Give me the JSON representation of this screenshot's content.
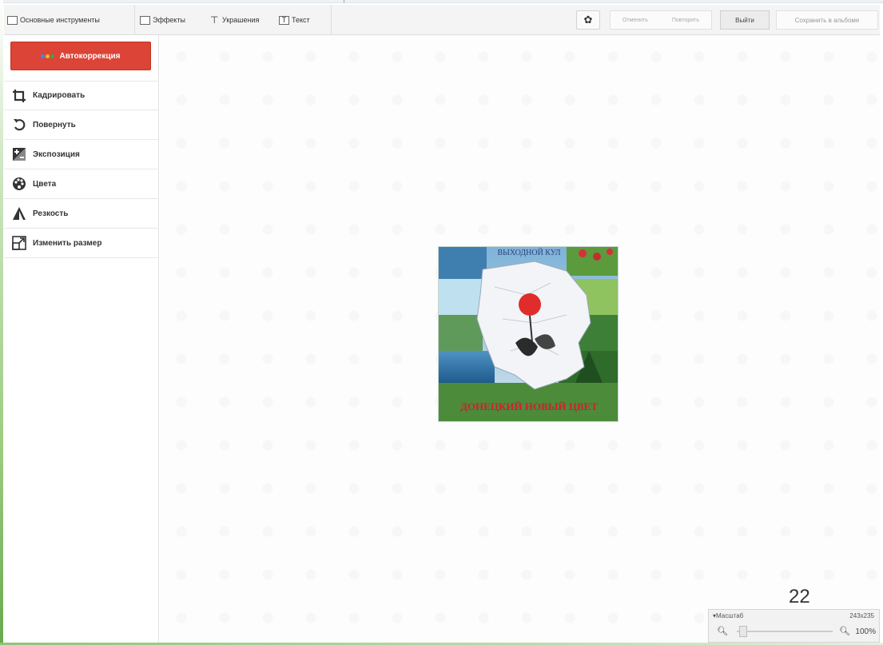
{
  "toolbar": {
    "tabs": [
      {
        "label": "Основные инструменты",
        "icon": "image-icon"
      },
      {
        "label": "Эффекты",
        "icon": "effects-icon"
      },
      {
        "label": "Украшения",
        "icon": "brush-icon"
      },
      {
        "label": "Текст",
        "icon": "text-icon"
      }
    ],
    "settings_icon": "gear-icon",
    "undo_label": "Отменить",
    "redo_label": "Повторить",
    "exit_label": "Выйти",
    "save_label": "Сохранить в альбоме"
  },
  "sidebar": {
    "auto_correct_label": "Автокоррекция",
    "items": [
      {
        "label": "Кадрировать",
        "icon": "crop-icon"
      },
      {
        "label": "Повернуть",
        "icon": "rotate-icon"
      },
      {
        "label": "Экспозиция",
        "icon": "exposure-icon"
      },
      {
        "label": "Цвета",
        "icon": "palette-icon"
      },
      {
        "label": "Резкость",
        "icon": "sharpness-icon"
      },
      {
        "label": "Изменить размер",
        "icon": "resize-icon"
      }
    ]
  },
  "photo": {
    "top_text": "ВЫХОДНОЙ КУЛ",
    "bottom_text": "ДОНЕЦКИЙ НОВЫЙ ЦВЕТ"
  },
  "slide": {
    "page_number": "22"
  },
  "zoom": {
    "title": "▾Масштаб",
    "size": "243x235",
    "value": "100%"
  },
  "colors": {
    "auto_button": "#db4437",
    "toolbar_bg": "#f4f4f4"
  }
}
